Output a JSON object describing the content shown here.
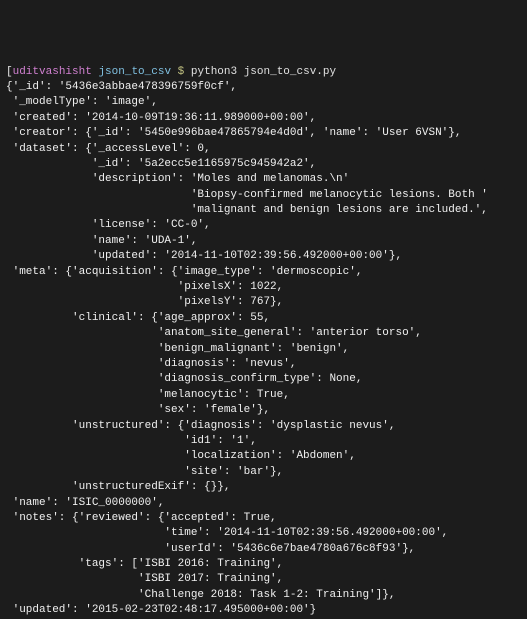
{
  "prompt": {
    "bracket_open": "[",
    "user": "uditvashisht",
    "path": "json_to_csv",
    "dollar": "$",
    "command": "python3 json_to_csv.py"
  },
  "output": {
    "line1": "{'_id': '5436e3abbae478396759f0cf',",
    "line2": " '_modelType': 'image',",
    "line3": " 'created': '2014-10-09T19:36:11.989000+00:00',",
    "line4": " 'creator': {'_id': '5450e996bae47865794e4d0d', 'name': 'User 6VSN'},",
    "line5": " 'dataset': {'_accessLevel': 0,",
    "line6": "             '_id': '5a2ecc5e1165975c945942a2',",
    "line7": "             'description': 'Moles and melanomas.\\n'",
    "line8": "                            'Biopsy-confirmed melanocytic lesions. Both '",
    "line9": "                            'malignant and benign lesions are included.',",
    "line10": "             'license': 'CC-0',",
    "line11": "             'name': 'UDA-1',",
    "line12": "             'updated': '2014-11-10T02:39:56.492000+00:00'},",
    "line13": " 'meta': {'acquisition': {'image_type': 'dermoscopic',",
    "line14": "                          'pixelsX': 1022,",
    "line15": "                          'pixelsY': 767},",
    "line16": "          'clinical': {'age_approx': 55,",
    "line17": "                       'anatom_site_general': 'anterior torso',",
    "line18": "                       'benign_malignant': 'benign',",
    "line19": "                       'diagnosis': 'nevus',",
    "line20": "                       'diagnosis_confirm_type': None,",
    "line21": "                       'melanocytic': True,",
    "line22": "                       'sex': 'female'},",
    "line23": "          'unstructured': {'diagnosis': 'dysplastic nevus',",
    "line24": "                           'id1': '1',",
    "line25": "                           'localization': 'Abdomen',",
    "line26": "                           'site': 'bar'},",
    "line27": "          'unstructuredExif': {}},",
    "line28": " 'name': 'ISIC_0000000',",
    "line29": " 'notes': {'reviewed': {'accepted': True,",
    "line30": "                        'time': '2014-11-10T02:39:56.492000+00:00',",
    "line31": "                        'userId': '5436c6e7bae4780a676c8f93'},",
    "line32": "           'tags': ['ISBI 2016: Training',",
    "line33": "                    'ISBI 2017: Training',",
    "line34": "                    'Challenge 2018: Task 1-2: Training']},",
    "line35": " 'updated': '2015-02-23T02:48:17.495000+00:00'}"
  }
}
